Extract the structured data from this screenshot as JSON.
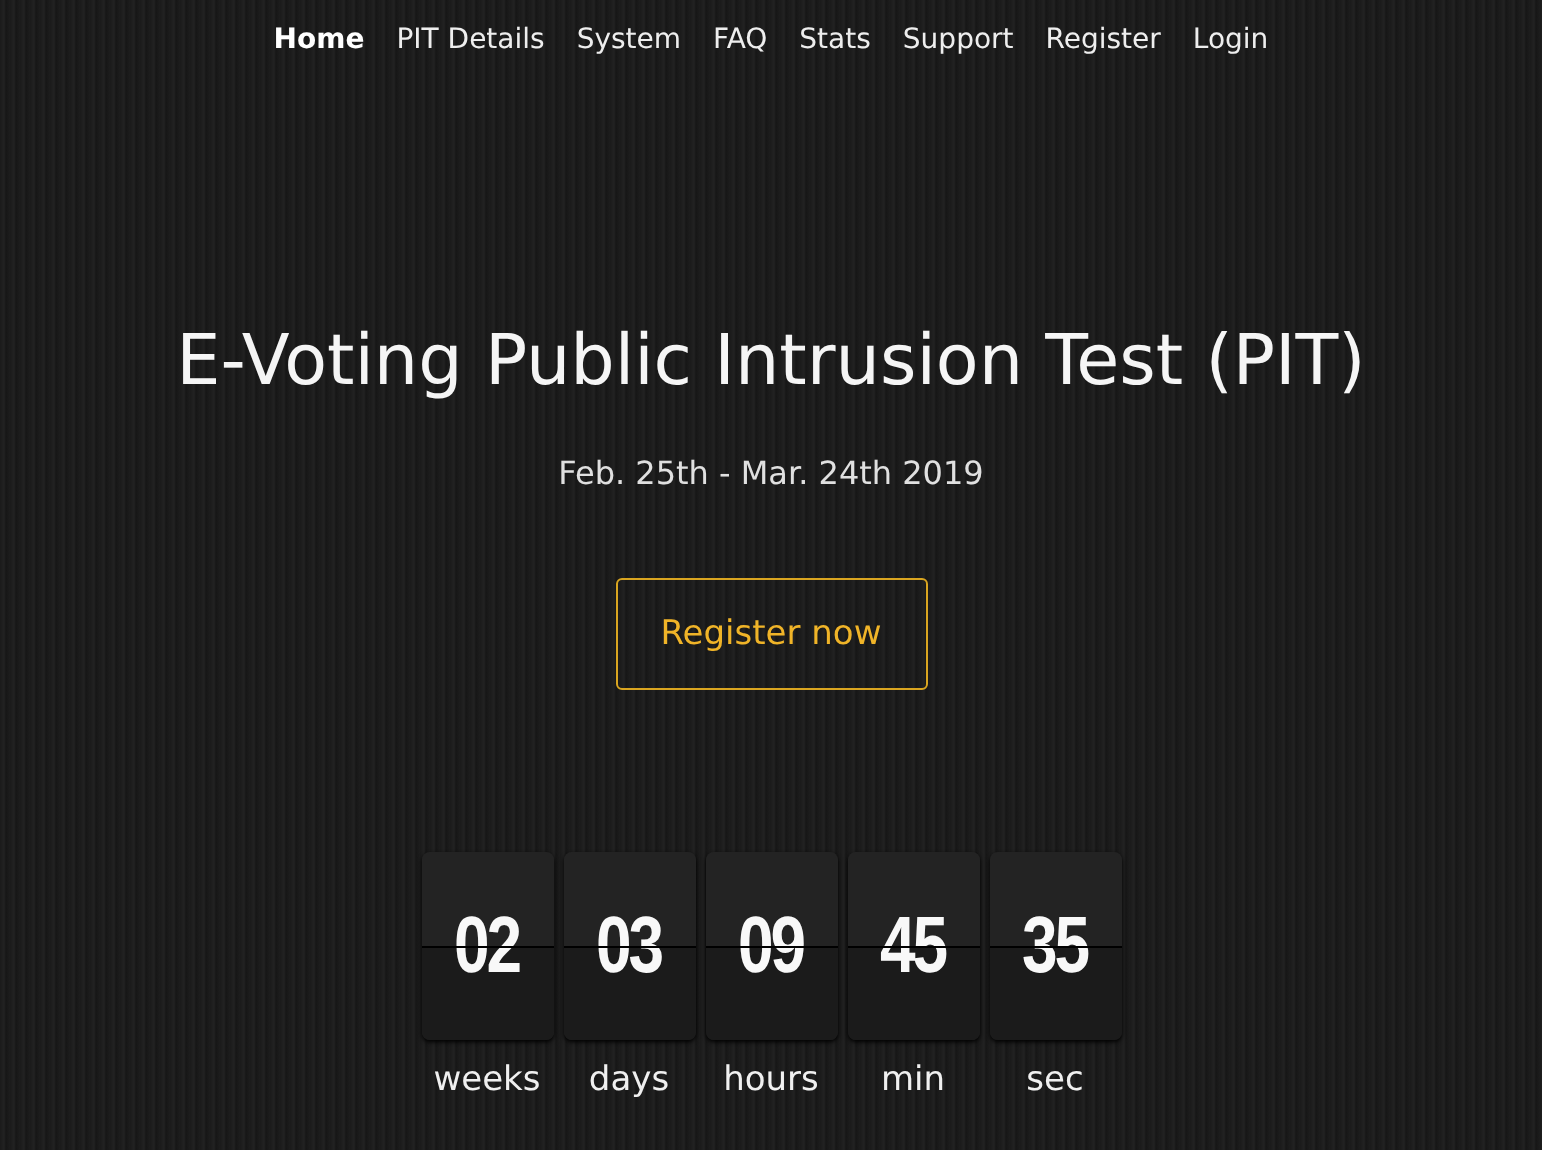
{
  "nav": [
    {
      "label": "Home",
      "selected": true
    },
    {
      "label": "PIT Details",
      "selected": false
    },
    {
      "label": "System",
      "selected": false
    },
    {
      "label": "FAQ",
      "selected": false
    },
    {
      "label": "Stats",
      "selected": false
    },
    {
      "label": "Support",
      "selected": false
    },
    {
      "label": "Register",
      "selected": false
    },
    {
      "label": "Login",
      "selected": false
    }
  ],
  "title": "E-Voting Public Intrusion Test (PIT)",
  "dates": "Feb. 25th - Mar. 24th 2019",
  "cta": "Register now",
  "countdown": [
    {
      "value": "02",
      "unit": "weeks"
    },
    {
      "value": "03",
      "unit": "days"
    },
    {
      "value": "09",
      "unit": "hours"
    },
    {
      "value": "45",
      "unit": "min"
    },
    {
      "value": "35",
      "unit": "sec"
    }
  ]
}
